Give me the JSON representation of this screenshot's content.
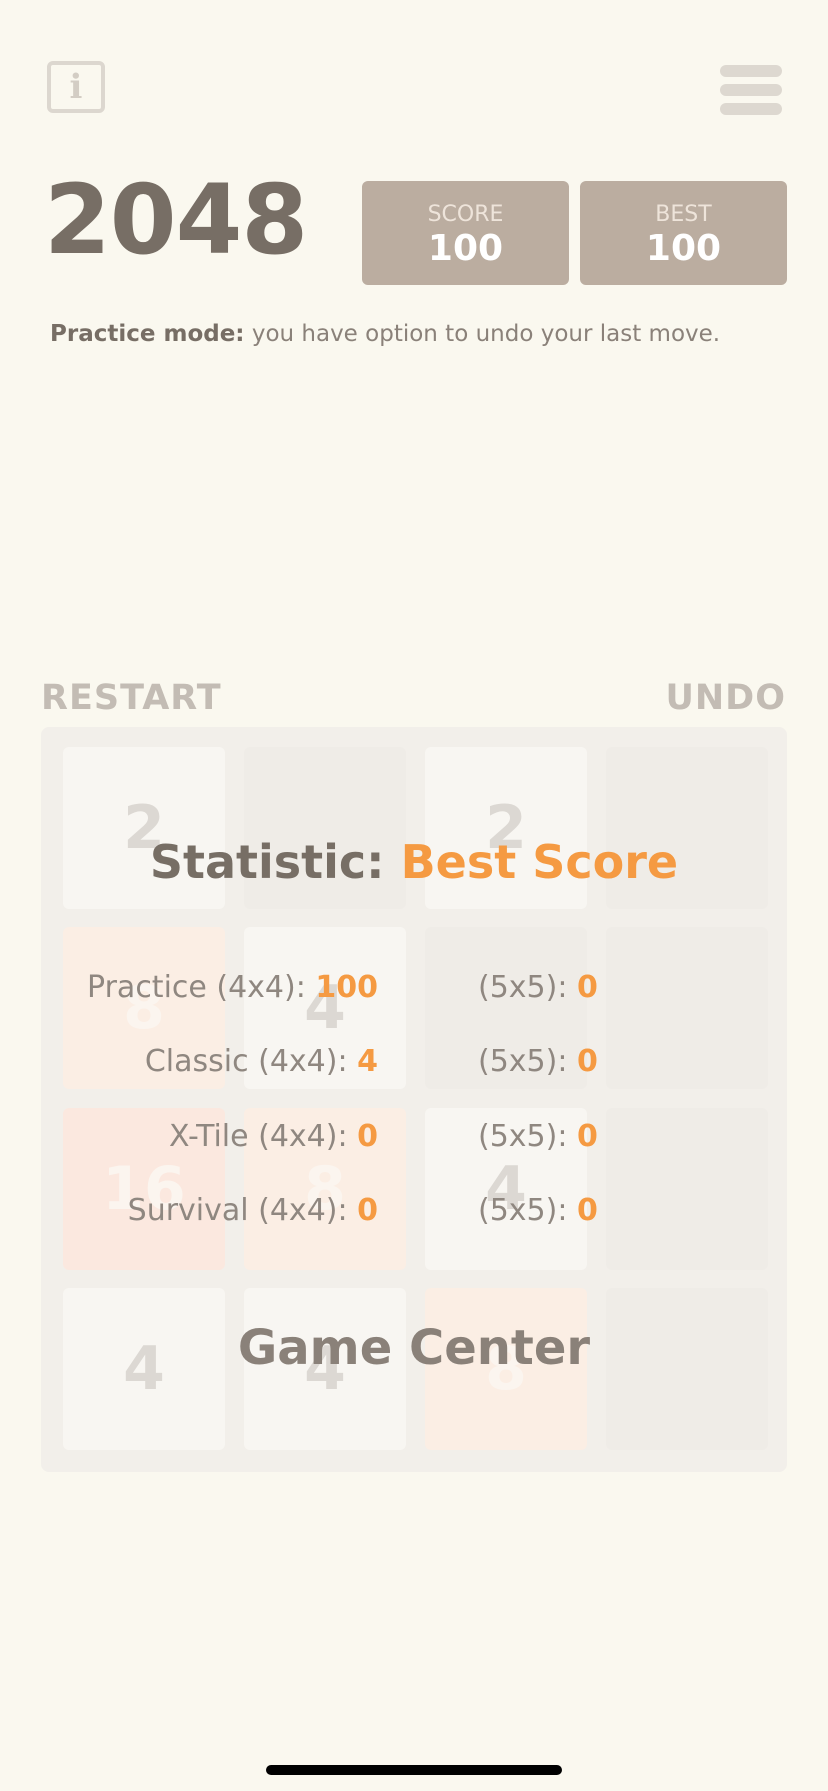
{
  "header": {
    "logo": "2048",
    "info_icon": "info-icon",
    "menu_icon": "hamburger-menu-icon",
    "score_label": "SCORE",
    "score_value": "100",
    "best_label": "BEST",
    "best_value": "100"
  },
  "practice_note": {
    "bold": "Practice mode:",
    "text": " you have option to undo your last move."
  },
  "controls": {
    "restart_label": "RESTART",
    "undo_label": "UNDO"
  },
  "board": {
    "tiles": [
      "2",
      "",
      "2",
      "",
      "8",
      "4",
      "",
      "",
      "16",
      "8",
      "4",
      "",
      "4",
      "4",
      "8",
      ""
    ]
  },
  "statistic": {
    "title": "Statistic:",
    "subtitle": "Best Score",
    "rows": [
      {
        "label": "Practice (4x4): ",
        "value": "100",
        "label5": "(5x5): ",
        "value5": "0"
      },
      {
        "label": "Classic (4x4): ",
        "value": "4",
        "label5": "(5x5): ",
        "value5": "0"
      },
      {
        "label": "X-Tile (4x4): ",
        "value": "0",
        "label5": "(5x5): ",
        "value5": "0"
      },
      {
        "label": "Survival (4x4): ",
        "value": "0",
        "label5": "(5x5): ",
        "value5": "0"
      }
    ],
    "game_center_label": "Game Center"
  },
  "colors": {
    "background": "#faf8ef",
    "accent": "#f59a42",
    "score_box": "#bbada0",
    "text": "#776e65"
  }
}
